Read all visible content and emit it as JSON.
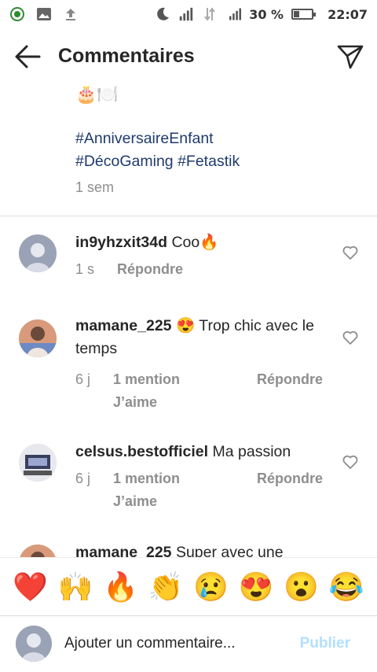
{
  "status_bar": {
    "battery_percent": "30 %",
    "battery_level": 0.3,
    "time": "22:07",
    "left_icons": [
      "data-saver-icon",
      "image-icon",
      "upload-icon"
    ],
    "right_icons": [
      "moon-icon",
      "signal-icon",
      "data-transfer-icon",
      "signal-h-icon",
      "battery-icon"
    ]
  },
  "header": {
    "title": "Commentaires"
  },
  "caption": {
    "emojis": "🎂🍽️",
    "hashtags": [
      "#AnniversaireEnfant",
      "#DécoGaming",
      "#Fetastik"
    ],
    "time": "1 sem"
  },
  "comments": [
    {
      "username": "in9yhzxit34d",
      "text": "Coo🔥",
      "time": "1 s",
      "reply_label": "Répondre"
    },
    {
      "username": "mamane_225",
      "text": "😍 Trop chic avec le temps",
      "time": "6 j",
      "mention_label": "1 mention J’aime",
      "reply_label": "Répondre"
    },
    {
      "username": "celsus.bestofficiel",
      "text": "Ma passion",
      "time": "6 j",
      "mention_label": "1 mention J’aime",
      "reply_label": "Répondre"
    },
    {
      "username": "mamane_225",
      "text": "Super avec une"
    }
  ],
  "emoji_bar": [
    "❤️",
    "🙌",
    "🔥",
    "👏",
    "😢",
    "😍",
    "😮",
    "😂"
  ],
  "input": {
    "placeholder": "Ajouter un commentaire...",
    "publish_label": "Publier"
  },
  "colors": {
    "hashtag": "#1e3a6e",
    "muted": "#8e8e8e",
    "publish_disabled": "#b2dffc"
  }
}
